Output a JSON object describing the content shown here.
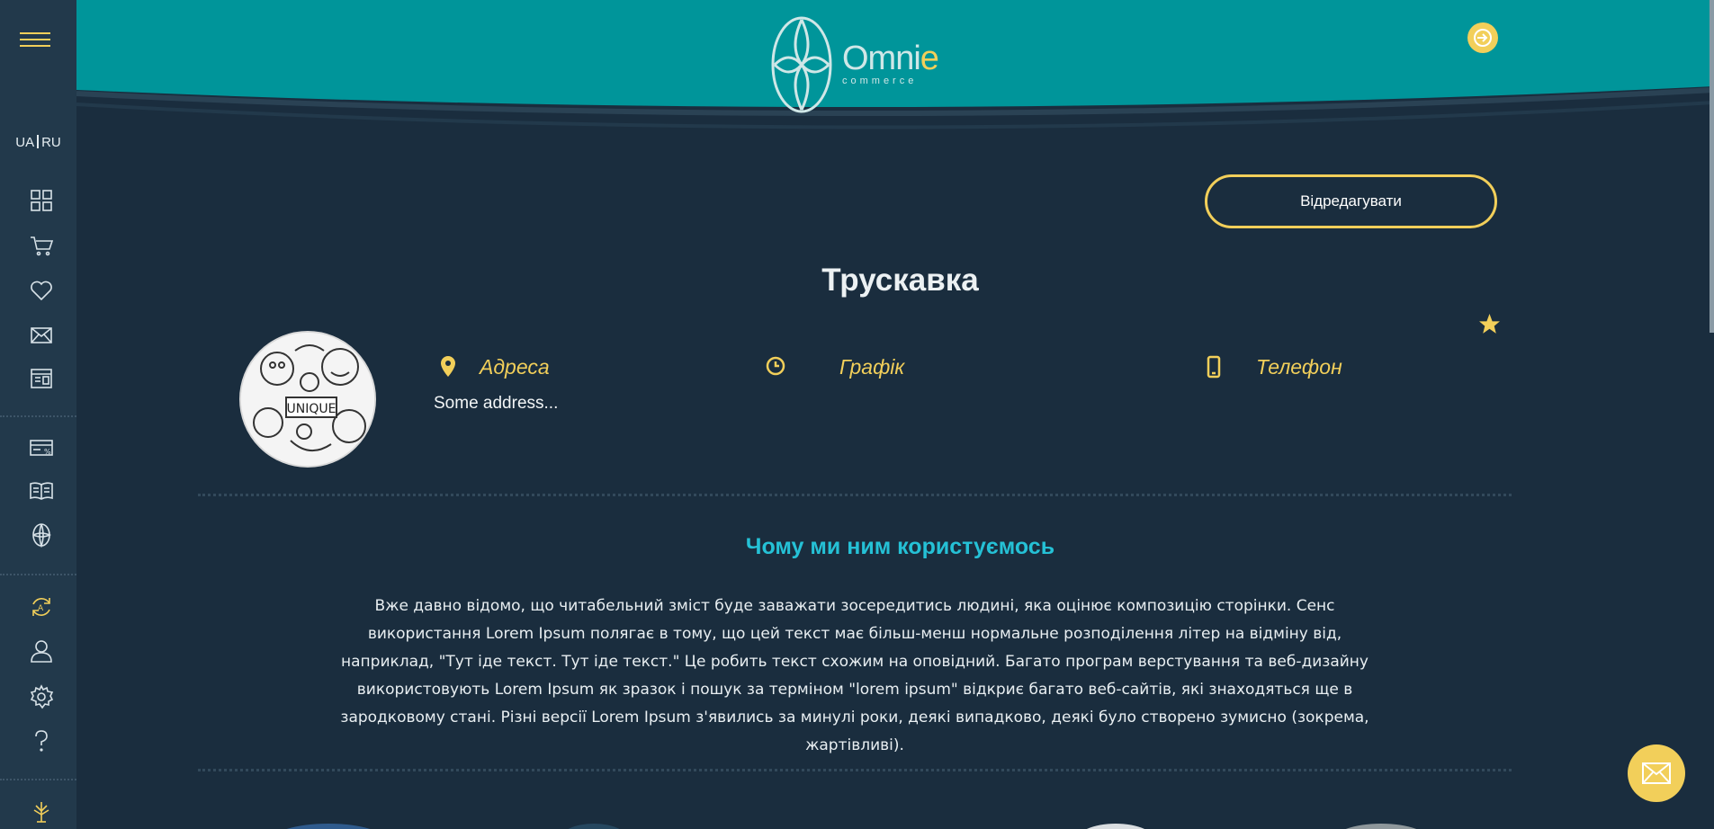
{
  "lang": {
    "ua": "UA",
    "ru": "RU"
  },
  "logo": {
    "brand": "Omni",
    "brand_accent": "e",
    "sub": "commerce"
  },
  "edit_label": "Відредагувати",
  "store": {
    "name": "Трускавка",
    "address_label": "Адреса",
    "schedule_label": "Графік",
    "phone_label": "Телефон",
    "address_value": "Some address...",
    "avatar_caption": "UNIQUE"
  },
  "about": {
    "title": "Чому ми ним користуємось",
    "text": "Вже давно відомо, що читабельний зміст буде заважати зосередитись людині, яка оцінює композицію сторінки. Сенс використання Lorem Ipsum полягає в тому, що цей текст має більш-менш нормальне розподілення літер на відміну від, наприклад, \"Тут іде текст. Тут іде текст.\" Це робить текст схожим на оповідний. Багато програм верстування та веб-дизайну використовують Lorem Ipsum як зразок і пошук за терміном \"lorem ipsum\" відкриє багато веб-сайтів, які знаходяться ще в зародковому стані. Різні версії Lorem Ipsum з'явились за минулі роки, деякі випадково, деякі було створено зумисно (зокрема, жартівливі)."
  },
  "colors": {
    "accent": "#f2cf5a",
    "teal": "#00959a",
    "background": "#1a2d3e",
    "sidebar": "#22394b",
    "cyan_title": "#25c1d6"
  },
  "icons": {
    "sidebar": [
      "dashboard-icon",
      "cart-icon",
      "heart-icon",
      "mail-icon",
      "layout-icon",
      "discount-card-icon",
      "catalog-book-icon",
      "omnie-logo-icon",
      "sync-icon",
      "user-icon",
      "settings-icon",
      "help-icon",
      "tree-icon"
    ],
    "header": [
      "login-icon"
    ],
    "info": [
      "location-pin-icon",
      "clock-icon",
      "phone-icon"
    ],
    "misc": [
      "star-icon",
      "mail-fab-icon",
      "hamburger-menu-icon"
    ]
  }
}
